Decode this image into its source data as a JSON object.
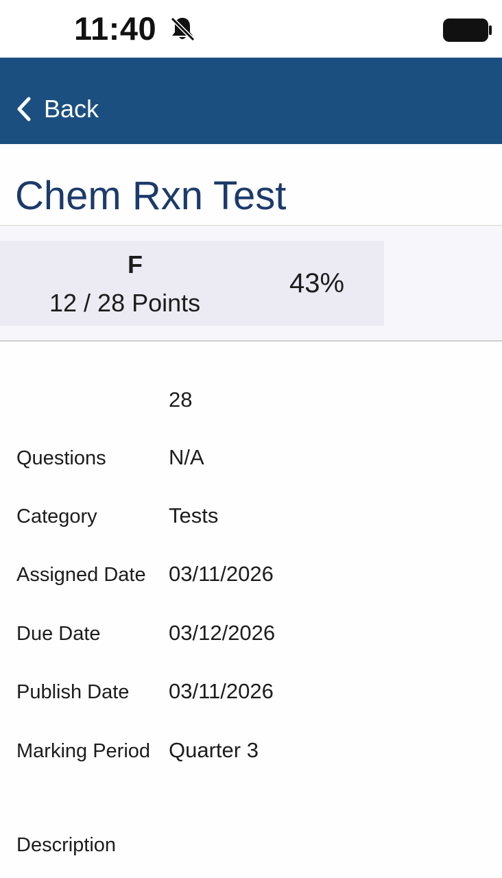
{
  "status_bar": {
    "time": "11:40",
    "battery": "",
    "icons": [
      "bell-slash-icon",
      "battery-icon"
    ]
  },
  "nav": {
    "back_label": "Back",
    "bar_color": "#1b4f80"
  },
  "title": "Chem Rxn Test",
  "grade": {
    "letter": "F",
    "points": "12 / 28 Points",
    "percent": "43%"
  },
  "details": {
    "total_points": "28",
    "rows": [
      {
        "label": "Questions",
        "value": "N/A"
      },
      {
        "label": "Category",
        "value": "Tests"
      },
      {
        "label": "Assigned Date",
        "value": "03/11/2026"
      },
      {
        "label": "Due Date",
        "value": "03/12/2026"
      },
      {
        "label": "Publish Date",
        "value": "03/11/2026"
      },
      {
        "label": "Marking Period",
        "value": "Quarter 3"
      },
      {
        "label": "Description",
        "value": ""
      }
    ]
  }
}
